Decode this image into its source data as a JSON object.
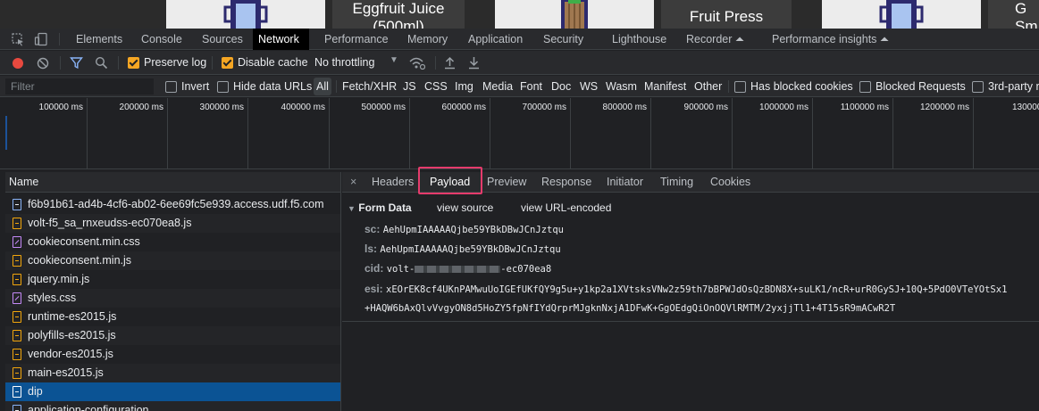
{
  "page_strip": {
    "cards": [
      {
        "text": ""
      },
      {
        "text": "Eggfruit Juice (500ml)"
      },
      {
        "text": ""
      },
      {
        "text": "Fruit Press"
      },
      {
        "text": ""
      },
      {
        "text": "G Sm"
      }
    ]
  },
  "devtools": {
    "tabs": [
      "Elements",
      "Console",
      "Sources",
      "Network",
      "Performance",
      "Memory",
      "Application",
      "Security",
      "Lighthouse",
      "Recorder ⏶",
      "Performance insights ⏶"
    ],
    "active_tab": "Network"
  },
  "toolbar": {
    "preserve_log": {
      "label": "Preserve log",
      "checked": true
    },
    "disable_cache": {
      "label": "Disable cache",
      "checked": true
    },
    "throttling": "No throttling"
  },
  "filter_bar": {
    "placeholder": "Filter",
    "invert": "Invert",
    "hide_data_urls": "Hide data URLs",
    "types": [
      "All",
      "Fetch/XHR",
      "JS",
      "CSS",
      "Img",
      "Media",
      "Font",
      "Doc",
      "WS",
      "Wasm",
      "Manifest",
      "Other"
    ],
    "selected_type": "All",
    "has_blocked_cookies": "Has blocked cookies",
    "blocked_requests": "Blocked Requests",
    "third_party": "3rd-party r"
  },
  "overview": {
    "ticks": [
      "100000 ms",
      "200000 ms",
      "300000 ms",
      "400000 ms",
      "500000 ms",
      "600000 ms",
      "700000 ms",
      "800000 ms",
      "900000 ms",
      "1000000 ms",
      "1100000 ms",
      "1200000 ms",
      "1300000 m"
    ]
  },
  "requests": {
    "header": "Name",
    "rows": [
      {
        "name": "f6b91b61-ad4b-4cf6-ab02-6ee69fc5e939.access.udf.f5.com",
        "type": "doc"
      },
      {
        "name": "volt-f5_sa_rnxeudss-ec070ea8.js",
        "type": "js"
      },
      {
        "name": "cookieconsent.min.css",
        "type": "css"
      },
      {
        "name": "cookieconsent.min.js",
        "type": "js"
      },
      {
        "name": "jquery.min.js",
        "type": "js"
      },
      {
        "name": "styles.css",
        "type": "css"
      },
      {
        "name": "runtime-es2015.js",
        "type": "js"
      },
      {
        "name": "polyfills-es2015.js",
        "type": "js"
      },
      {
        "name": "vendor-es2015.js",
        "type": "js"
      },
      {
        "name": "main-es2015.js",
        "type": "js"
      },
      {
        "name": "dip",
        "type": "doc",
        "selected": true
      },
      {
        "name": "application-configuration",
        "type": "doc"
      }
    ]
  },
  "detail": {
    "close": "×",
    "tabs": [
      "Headers",
      "Payload",
      "Preview",
      "Response",
      "Initiator",
      "Timing",
      "Cookies"
    ],
    "active_tab": "Payload",
    "form_data": {
      "title": "Form Data",
      "view_source": "view source",
      "view_url_encoded": "view URL-encoded",
      "fields": [
        {
          "key": "sc:",
          "value": "AehUpmIAAAAAQjbe59YBkDBwJCnJztqu"
        },
        {
          "key": "ls:",
          "value": "AehUpmIAAAAAQjbe59YBkDBwJCnJztqu"
        },
        {
          "key": "cid:",
          "value_prefix": "volt-",
          "value_suffix": "-ec070ea8"
        },
        {
          "key": "esi:",
          "value": "xEOrEK8cf4UKnPAMwuUoIGEfUKfQY9g5u+y1kp2a1XVtsksVNw2z59th7bBPWJdOsQzBDN8X+suLK1/ncR+urR0GySJ+10Q+5PdO0VTeYOtSx1",
          "value_cont": "+HAQW6bAxQlvVvgyON8d5HoZY5fpNfIYdQrprMJgknNxjA1DFwK+GgOEdgQiOnOQVlRMTM/2yxjjTl1+4T15sR9mACwR2T"
        }
      ]
    }
  },
  "colors": {
    "accent_checkbox": "#f5a623",
    "record_button": "#e8493f",
    "filter_icon": "#8ab4f8",
    "selected_row": "#0b5394",
    "highlight_box": "#e53b6c"
  }
}
